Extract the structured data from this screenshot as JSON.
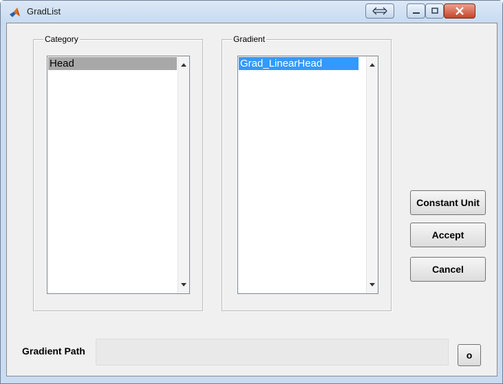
{
  "window": {
    "title": "GradList"
  },
  "colors": {
    "selection_active": "#3399ff",
    "selection_inactive": "#a8a8a8",
    "title_bar": "#c8dbf1",
    "close_button": "#c7432b"
  },
  "category": {
    "label": "Category",
    "items": [
      {
        "label": "Head",
        "selected": true
      }
    ]
  },
  "gradient": {
    "label": "Gradient",
    "items": [
      {
        "label": "Grad_LinearHead",
        "selected": true
      }
    ]
  },
  "buttons": {
    "constant_unit": "Constant Unit",
    "accept": "Accept",
    "cancel": "Cancel",
    "browse": "o"
  },
  "gradient_path": {
    "label": "Gradient Path",
    "value": ""
  },
  "icons": {
    "app": "matlab-logo-icon",
    "resize": "resize-horizontal-icon",
    "minimize": "minimize-icon",
    "maximize": "maximize-icon",
    "close": "close-icon",
    "scroll_up": "scroll-up-arrow-icon",
    "scroll_down": "scroll-down-arrow-icon"
  }
}
